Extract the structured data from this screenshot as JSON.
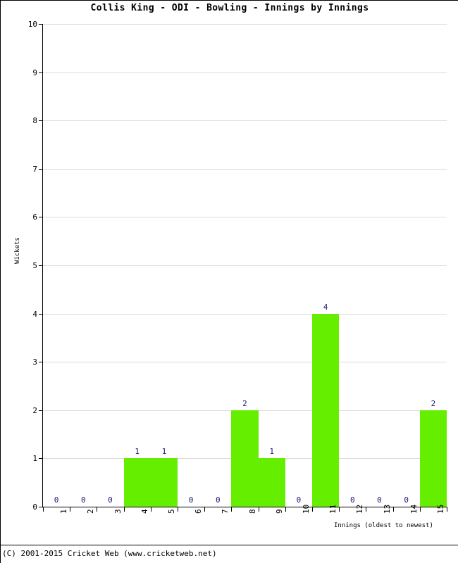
{
  "chart_data": {
    "type": "bar",
    "title": "Collis King - ODI - Bowling - Innings by Innings",
    "xlabel": "Innings (oldest to newest)",
    "ylabel": "Wickets",
    "categories": [
      "1",
      "2",
      "3",
      "4",
      "5",
      "6",
      "7",
      "8",
      "9",
      "10",
      "11",
      "12",
      "13",
      "14",
      "15"
    ],
    "values": [
      0,
      0,
      0,
      1,
      1,
      0,
      0,
      2,
      1,
      0,
      4,
      0,
      0,
      0,
      2
    ],
    "data_labels": [
      "0",
      "0",
      "0",
      "1",
      "1",
      "0",
      "0",
      "2",
      "1",
      "0",
      "4",
      "0",
      "0",
      "0",
      "2"
    ],
    "ylim": [
      0,
      10
    ],
    "yticks": [
      0,
      1,
      2,
      3,
      4,
      5,
      6,
      7,
      8,
      9,
      10
    ],
    "ytick_labels": [
      "0",
      "1",
      "2",
      "3",
      "4",
      "5",
      "6",
      "7",
      "8",
      "9",
      "10"
    ],
    "grid": true,
    "legend": null,
    "bar_color": "#66ee00",
    "grid_color": "#dcdcdc",
    "label_color": "#191970",
    "axis_color": "#000000"
  },
  "footer": {
    "copyright": "(C) 2001-2015 Cricket Web (www.cricketweb.net)"
  }
}
